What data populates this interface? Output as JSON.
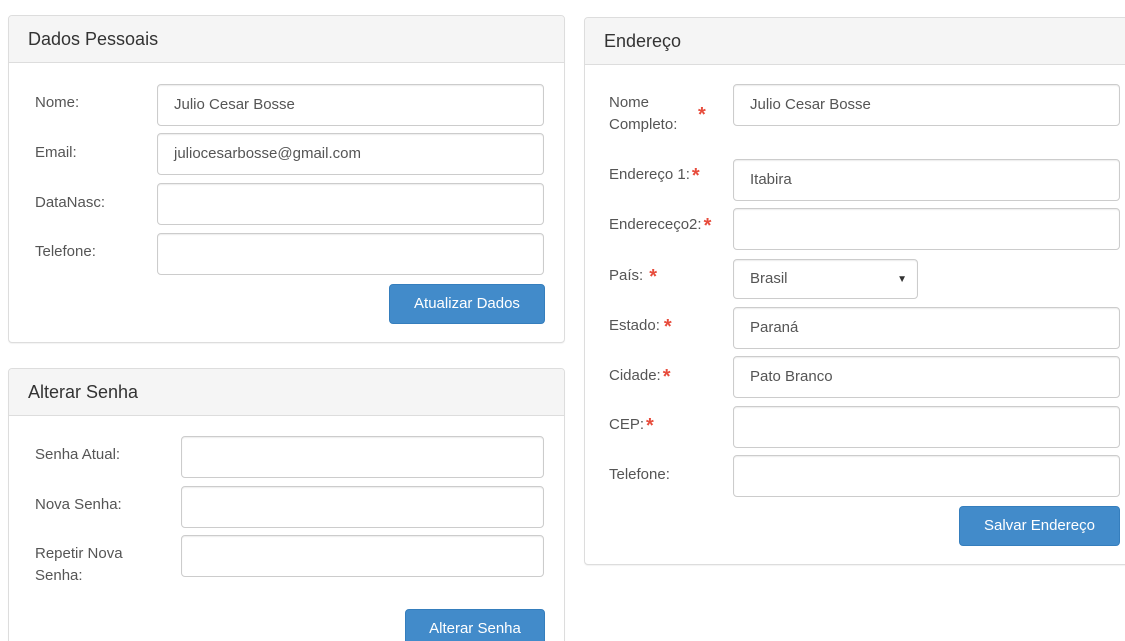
{
  "personal": {
    "heading": "Dados Pessoais",
    "name_label": "Nome:",
    "name_value": "Julio Cesar Bosse",
    "email_label": "Email:",
    "email_value": "juliocesarbosse@gmail.com",
    "birth_label": "DataNasc:",
    "birth_value": "",
    "phone_label": "Telefone:",
    "phone_value": "",
    "update_button": "Atualizar Dados"
  },
  "password": {
    "heading": "Alterar Senha",
    "current_label": "Senha Atual:",
    "new_label": "Nova Senha:",
    "repeat_label_line1": "Repetir Nova",
    "repeat_label_line2": "Senha:",
    "change_button": "Alterar Senha"
  },
  "address": {
    "heading": "Endereço",
    "fullname_label_line1": "Nome",
    "fullname_label_line2": "Completo:",
    "fullname_value": "Julio Cesar Bosse",
    "address1_label": "Endereço 1:",
    "address1_value": "Itabira",
    "address2_label": "Endereceço2:",
    "address2_value": "",
    "country_label": "País:",
    "country_value": "Brasil",
    "state_label": "Estado:",
    "state_value": "Paraná",
    "city_label": "Cidade:",
    "city_value": "Pato Branco",
    "zip_label": "CEP:",
    "zip_value": "",
    "phone_label": "Telefone:",
    "phone_value": "",
    "save_button": "Salvar Endereço",
    "required_mark": "*"
  },
  "icons": {
    "select_arrow": "▼"
  },
  "colors": {
    "primary_button": "#428bca",
    "required_star": "#e74c3c",
    "panel_heading_bg": "#f5f5f5"
  }
}
